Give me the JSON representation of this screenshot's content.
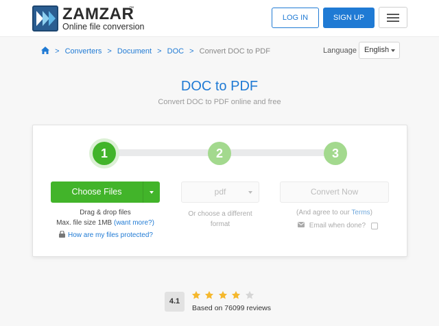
{
  "brand": {
    "name": "ZAMZAR",
    "trademark": "™",
    "tagline": "Online file conversion",
    "color": "#2a5d91"
  },
  "header": {
    "login_label": "LOG IN",
    "signup_label": "SIGN UP",
    "menu_icon": "hamburger-icon"
  },
  "breadcrumb": {
    "home_icon": "home-icon",
    "separator": ">",
    "items": [
      "Converters",
      "Document",
      "DOC"
    ],
    "current": "Convert DOC to PDF"
  },
  "language": {
    "label": "Language",
    "selected": "English"
  },
  "page": {
    "title": "DOC to PDF",
    "subtitle": "Convert DOC to PDF online and free"
  },
  "steps": {
    "step1": {
      "number": "1",
      "button_label": "Choose Files",
      "drag_text": "Drag & drop files",
      "max_size_text": "Max. file size 1MB",
      "want_more_link": "(want more?)",
      "protected_link": "How are my files protected?"
    },
    "step2": {
      "number": "2",
      "format_placeholder": "pdf",
      "hint": "Or choose a different format"
    },
    "step3": {
      "number": "3",
      "button_label": "Convert Now",
      "agree_prefix": "(And agree to our ",
      "terms_link": "Terms",
      "agree_suffix": ")",
      "email_label": "Email when done?",
      "email_checked": false
    }
  },
  "rating": {
    "score": "4.1",
    "stars_filled": 4,
    "stars_total": 5,
    "reviews_text": "Based on 76099 reviews"
  },
  "colors": {
    "accent": "#1f7ad4",
    "green": "#42b42a",
    "green_light": "#a3d98e",
    "star": "#f5b82e"
  }
}
